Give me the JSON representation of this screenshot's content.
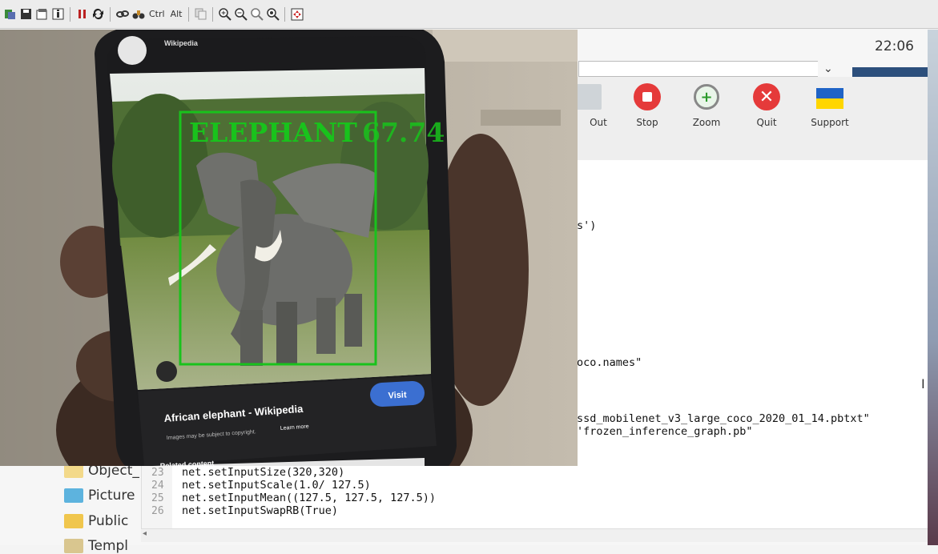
{
  "toolbar": {
    "ctrl_label": "Ctrl",
    "alt_label": "Alt",
    "icons": [
      "clipboard-icon",
      "save-icon",
      "options-icon",
      "info-icon",
      "pause-icon",
      "refresh-icon",
      "chain-icon",
      "binoculars-icon",
      "copy-icon",
      "zoom-in-icon",
      "zoom-out-icon",
      "zoom-reset-icon",
      "zoom-fit-icon",
      "fullscreen-icon"
    ]
  },
  "clock": "22:06",
  "vnc_tools": {
    "items": [
      {
        "label": "Out",
        "icon": "zoom-out-icon"
      },
      {
        "label": "Stop",
        "icon": "stop-icon"
      },
      {
        "label": "Zoom",
        "icon": "zoom-icon"
      },
      {
        "label": "Quit",
        "icon": "quit-icon"
      },
      {
        "label": "Support",
        "icon": "ukraine-flag-icon"
      }
    ]
  },
  "camera": {
    "detection": {
      "label": "ELEPHANT",
      "score": "67.74",
      "color": "#19c21c"
    },
    "phone": {
      "header": "Wikipedia",
      "card_title": "African elephant - Wikipedia",
      "card_note": "Images may be subject to copyright.",
      "card_link": "Learn more",
      "visit_button": "Visit",
      "related": "Related content"
    }
  },
  "editor": {
    "fragments": [
      {
        "text": "s')"
      },
      {
        "text": "oco.names\""
      },
      {
        "text": "ssd_mobilenet_v3_large_coco_2020_01_14.pbtxt\""
      },
      {
        "text": "'frozen_inference_graph.pb\""
      }
    ],
    "lines": [
      {
        "num": "23",
        "code": "net.setInputSize(320,320)"
      },
      {
        "num": "24",
        "code": "net.setInputScale(1.0/ 127.5)"
      },
      {
        "num": "25",
        "code": "net.setInputMean((127.5, 127.5, 127.5))"
      },
      {
        "num": "26",
        "code": "net.setInputSwapRB(True)"
      }
    ]
  },
  "files": [
    {
      "name": "Object_",
      "color": "#f3d98a"
    },
    {
      "name": "Picture",
      "color": "#5db3de"
    },
    {
      "name": "Public",
      "color": "#f0c64d"
    },
    {
      "name": "Templ",
      "color": "#d9c68f"
    }
  ]
}
